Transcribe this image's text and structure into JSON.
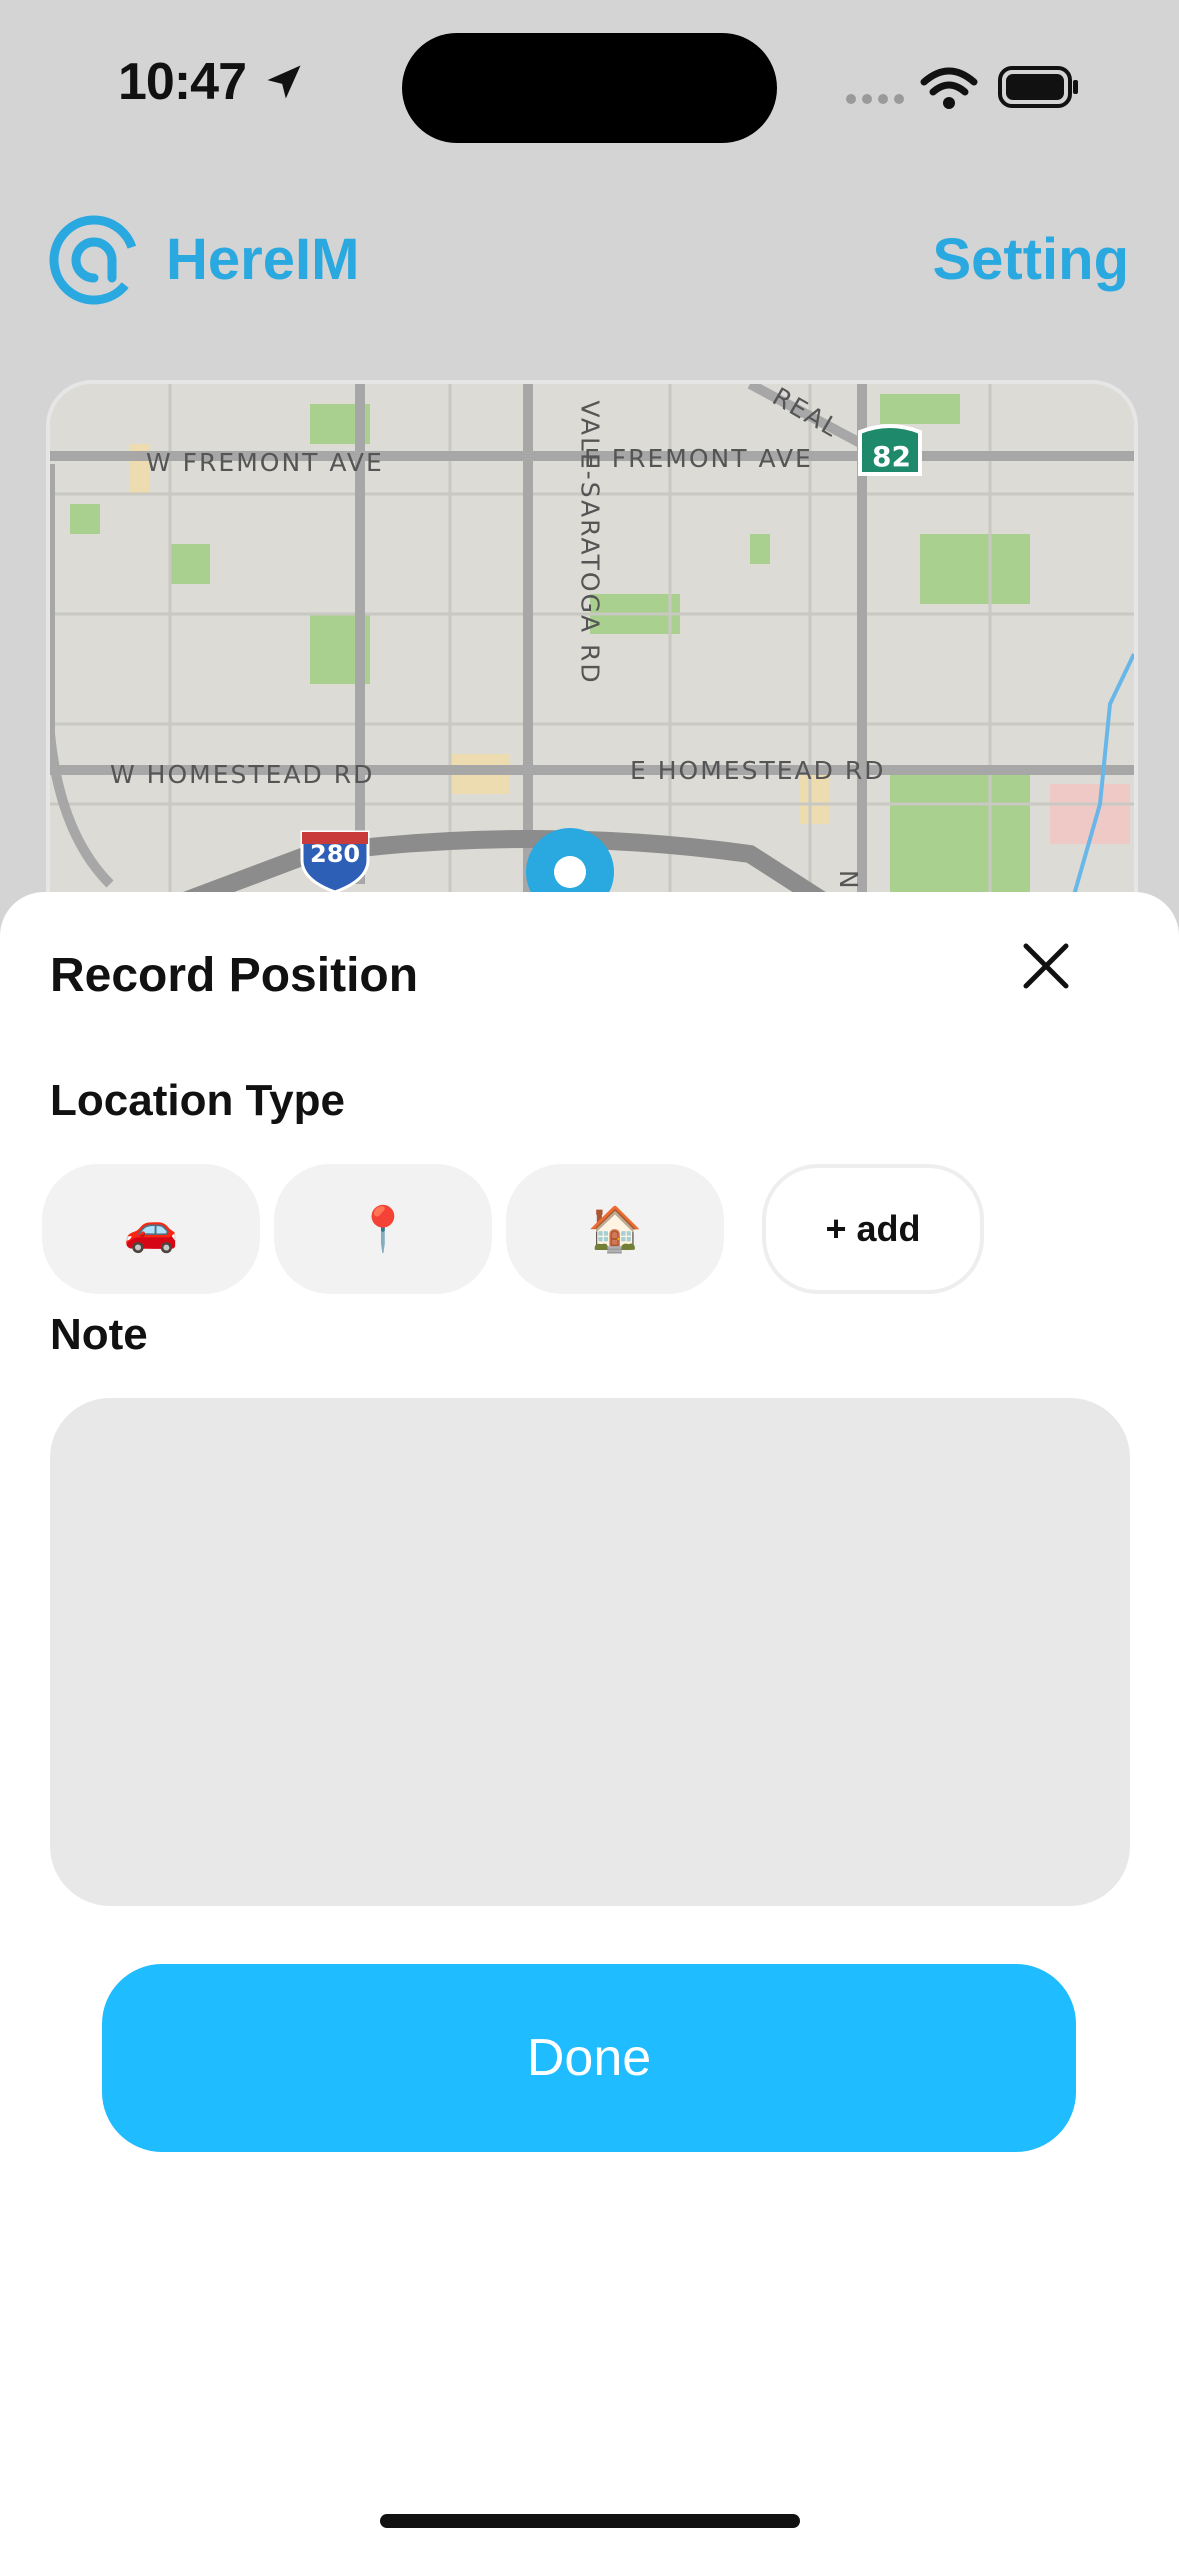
{
  "status_bar": {
    "time": "10:47"
  },
  "header": {
    "app_name": "HereIM",
    "setting_label": "Setting"
  },
  "map": {
    "labels": {
      "w_fremont": "W FREMONT AVE",
      "e_fremont": "E FREMONT AVE",
      "saratoga": "VALE-SARATOGA RD",
      "w_homestead": "W HOMESTEAD RD",
      "e_homestead": "E HOMESTEAD RD",
      "real": "REAL",
      "nw": "N W",
      "shield_280": "280",
      "shield_82": "82"
    }
  },
  "sheet": {
    "title": "Record Position",
    "location_type_label": "Location Type",
    "location_types": [
      {
        "emoji": "🚗",
        "icon": "car-icon"
      },
      {
        "emoji": "📍",
        "icon": "pin-icon"
      },
      {
        "emoji": "🏠",
        "icon": "house-icon"
      }
    ],
    "add_label": "+ add",
    "note_label": "Note",
    "note_value": "",
    "done_label": "Done"
  },
  "colors": {
    "accent": "#2aa8e0",
    "done_button": "#1fbcff",
    "note_bg": "#e8e8e8",
    "chip_bg": "#f2f2f2"
  }
}
